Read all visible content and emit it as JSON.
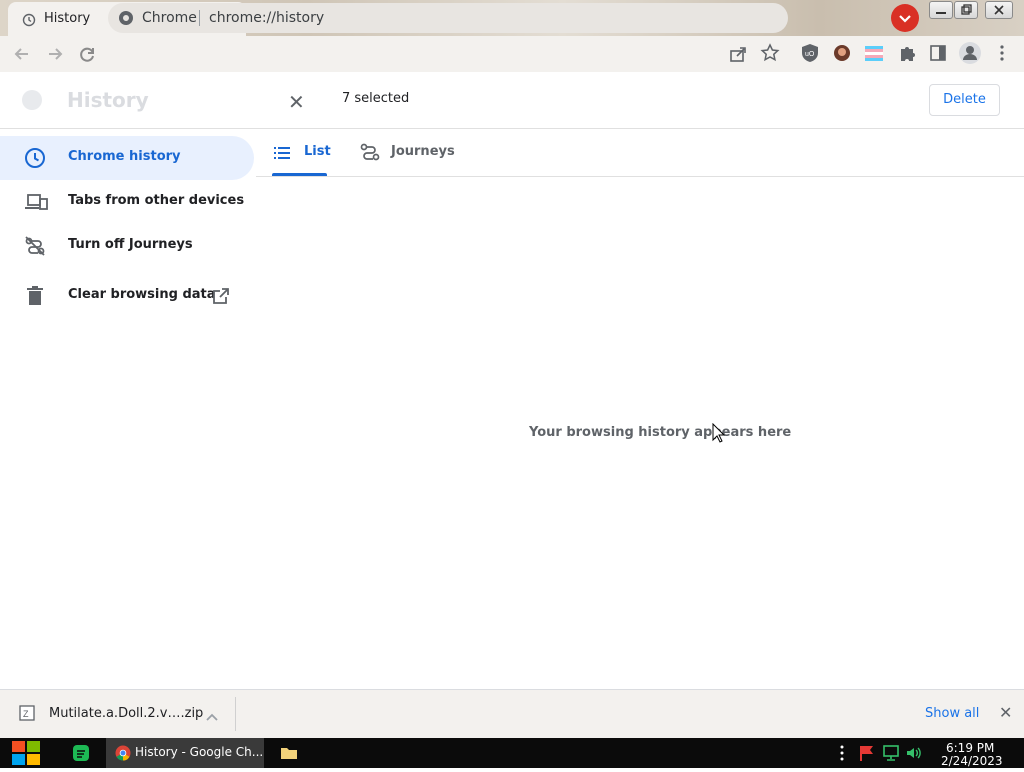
{
  "browser": {
    "tab_title": "History",
    "omnibox_site": "Chrome",
    "omnibox_url": "chrome://history"
  },
  "header": {
    "faded_title": "History",
    "selected_count": "7 selected",
    "delete_label": "Delete"
  },
  "sidebar": {
    "items": [
      {
        "label": "Chrome history",
        "icon": "clock-icon"
      },
      {
        "label": "Tabs from other devices",
        "icon": "devices-icon"
      },
      {
        "label": "Turn off Journeys",
        "icon": "journeys-off-icon"
      },
      {
        "label": "Clear browsing data",
        "icon": "trash-icon"
      }
    ]
  },
  "tabs": [
    {
      "label": "List",
      "icon": "list-icon"
    },
    {
      "label": "Journeys",
      "icon": "journeys-icon"
    }
  ],
  "main": {
    "empty_message": "Your browsing history appears here"
  },
  "download_bar": {
    "file_name": "Mutilate.a.Doll.2.v….zip",
    "show_all": "Show all"
  },
  "taskbar": {
    "chrome_task_label": "History - Google Ch...",
    "time": "6:19 PM",
    "date": "2/24/2023"
  },
  "colors": {
    "accent": "#1967d2",
    "accent_bg": "#e8f0fe",
    "toolbar_bg": "#f3f1ee",
    "red_buttons": "#d93025"
  }
}
